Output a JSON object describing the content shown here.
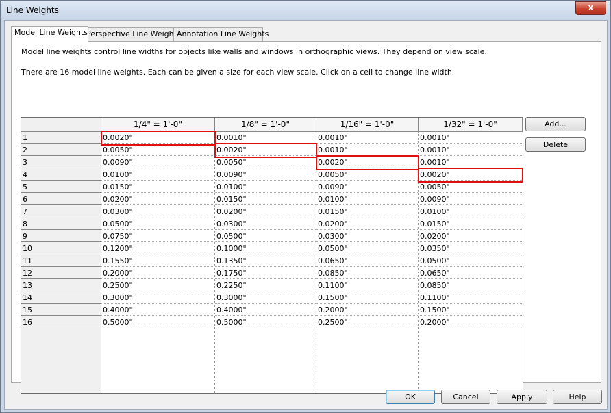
{
  "window": {
    "title": "Line Weights",
    "close_glyph": "x"
  },
  "tabs": [
    {
      "label": "Model Line Weights",
      "active": true
    },
    {
      "label": "Perspective Line Weights",
      "active": false
    },
    {
      "label": "Annotation Line Weights",
      "active": false
    }
  ],
  "description": {
    "line1": "Model line weights control line widths for objects like walls and windows in orthographic views. They depend on view scale.",
    "line2": "There are 16 model line weights. Each can be given a size for each view scale. Click on a cell to change line width."
  },
  "table": {
    "columns": [
      "1/4\" = 1'-0\"",
      "1/8\" = 1'-0\"",
      "1/16\" = 1'-0\"",
      "1/32\" = 1'-0\""
    ],
    "rows": [
      {
        "label": "1",
        "values": [
          "0.0020\"",
          "0.0010\"",
          "0.0010\"",
          "0.0010\""
        ]
      },
      {
        "label": "2",
        "values": [
          "0.0050\"",
          "0.0020\"",
          "0.0010\"",
          "0.0010\""
        ]
      },
      {
        "label": "3",
        "values": [
          "0.0090\"",
          "0.0050\"",
          "0.0020\"",
          "0.0010\""
        ]
      },
      {
        "label": "4",
        "values": [
          "0.0100\"",
          "0.0090\"",
          "0.0050\"",
          "0.0020\""
        ]
      },
      {
        "label": "5",
        "values": [
          "0.0150\"",
          "0.0100\"",
          "0.0090\"",
          "0.0050\""
        ]
      },
      {
        "label": "6",
        "values": [
          "0.0200\"",
          "0.0150\"",
          "0.0100\"",
          "0.0090\""
        ]
      },
      {
        "label": "7",
        "values": [
          "0.0300\"",
          "0.0200\"",
          "0.0150\"",
          "0.0100\""
        ]
      },
      {
        "label": "8",
        "values": [
          "0.0500\"",
          "0.0300\"",
          "0.0200\"",
          "0.0150\""
        ]
      },
      {
        "label": "9",
        "values": [
          "0.0750\"",
          "0.0500\"",
          "0.0300\"",
          "0.0200\""
        ]
      },
      {
        "label": "10",
        "values": [
          "0.1200\"",
          "0.1000\"",
          "0.0500\"",
          "0.0350\""
        ]
      },
      {
        "label": "11",
        "values": [
          "0.1550\"",
          "0.1350\"",
          "0.0650\"",
          "0.0500\""
        ]
      },
      {
        "label": "12",
        "values": [
          "0.2000\"",
          "0.1750\"",
          "0.0850\"",
          "0.0650\""
        ]
      },
      {
        "label": "13",
        "values": [
          "0.2500\"",
          "0.2250\"",
          "0.1100\"",
          "0.0850\""
        ]
      },
      {
        "label": "14",
        "values": [
          "0.3000\"",
          "0.3000\"",
          "0.1500\"",
          "0.1100\""
        ]
      },
      {
        "label": "15",
        "values": [
          "0.4000\"",
          "0.4000\"",
          "0.2000\"",
          "0.1500\""
        ]
      },
      {
        "label": "16",
        "values": [
          "0.5000\"",
          "0.5000\"",
          "0.2500\"",
          "0.2000\""
        ]
      }
    ],
    "highlighted_cells": [
      [
        0,
        0
      ],
      [
        1,
        1
      ],
      [
        2,
        2
      ],
      [
        3,
        3
      ]
    ],
    "highlight_color": "#e01010"
  },
  "side_buttons": {
    "add": "Add...",
    "delete": "Delete"
  },
  "footer_buttons": {
    "ok": "OK",
    "cancel": "Cancel",
    "apply": "Apply",
    "help": "Help"
  }
}
